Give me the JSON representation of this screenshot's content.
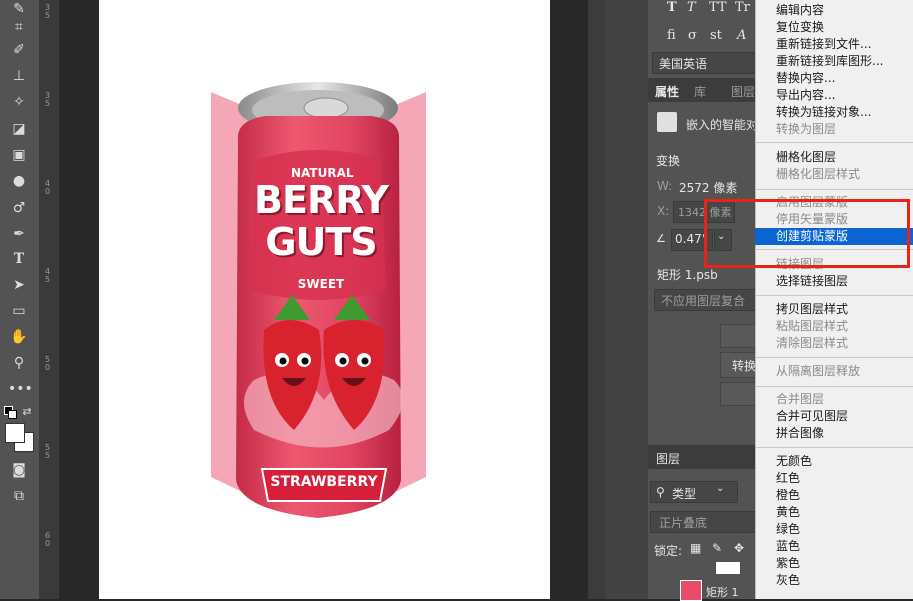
{
  "toolbar": {
    "tools": [
      "brush-tool-icon",
      "eraser-tool-icon",
      "crop-icon",
      "paintbrush-icon",
      "stamp-icon",
      "healing-brush-icon",
      "eraser-icon",
      "gradient-icon",
      "blur-drop-icon",
      "dodge-icon",
      "pen-tool-icon",
      "type-tool-icon",
      "path-selection-icon",
      "rectangle-icon",
      "hand-icon",
      "zoom-icon",
      "more-tools-icon"
    ],
    "type_glyph": "T"
  },
  "ruler": {
    "ticks": [
      "3",
      "5",
      "3",
      "5",
      "4",
      "0",
      "4",
      "5",
      "5",
      "0",
      "5",
      "5",
      "6",
      "0"
    ]
  },
  "can": {
    "brand_line1": "NATURAL",
    "brand_line2": "BERRY",
    "brand_line3": "GUTS",
    "brand_line4": "SWEET",
    "flavor": "STRAWBERRY"
  },
  "panel": {
    "character_row1": [
      "T",
      "T",
      "TT",
      "Tr"
    ],
    "character_row2": [
      "fi",
      "σ",
      "st",
      "A"
    ],
    "language": "美国英语",
    "tabs": [
      "属性",
      "库",
      "图层"
    ],
    "embedded_label": "嵌入的智能对",
    "transform_label": "变换",
    "w_label": "W:",
    "w_value": "2572 像素",
    "x_label": "X:",
    "x_value": "1342 像素",
    "angle_value": "0.47°",
    "file_name": "矩形 1.psb",
    "comp_placeholder": "不应用图层复合",
    "convert_label": "转换",
    "layers_tab": "图层",
    "filter_type": "类型",
    "blend_mode": "正片叠底",
    "lock_label": "锁定:",
    "layer_name": "矩形 1"
  },
  "menu": {
    "items": [
      {
        "label": "编辑内容",
        "state": "normal"
      },
      {
        "label": "复位变换",
        "state": "normal"
      },
      {
        "label": "重新链接到文件...",
        "state": "normal"
      },
      {
        "label": "重新链接到库图形...",
        "state": "normal"
      },
      {
        "label": "替换内容...",
        "state": "normal"
      },
      {
        "label": "导出内容...",
        "state": "normal"
      },
      {
        "label": "转换为链接对象...",
        "state": "normal"
      },
      {
        "label": "转换为图层",
        "state": "normal"
      },
      {
        "label": "栅格化图层",
        "state": "normal"
      },
      {
        "label": "栅格化图层样式",
        "state": "disabled"
      },
      {
        "label": "启用图层蒙版",
        "state": "disabled"
      },
      {
        "label": "停用矢量蒙版",
        "state": "disabled"
      },
      {
        "label": "创建剪贴蒙版",
        "state": "selected"
      },
      {
        "label": "链接图层",
        "state": "disabled"
      },
      {
        "label": "选择链接图层",
        "state": "normal"
      },
      {
        "label": "拷贝图层样式",
        "state": "normal"
      },
      {
        "label": "粘贴图层样式",
        "state": "disabled"
      },
      {
        "label": "清除图层样式",
        "state": "disabled"
      },
      {
        "label": "从隔离图层释放",
        "state": "disabled"
      },
      {
        "label": "合并图层",
        "state": "disabled"
      },
      {
        "label": "合并可见图层",
        "state": "normal"
      },
      {
        "label": "拼合图像",
        "state": "normal"
      },
      {
        "label": "无颜色",
        "state": "normal"
      },
      {
        "label": "红色",
        "state": "normal"
      },
      {
        "label": "橙色",
        "state": "normal"
      },
      {
        "label": "黄色",
        "state": "normal"
      },
      {
        "label": "绿色",
        "state": "normal"
      },
      {
        "label": "蓝色",
        "state": "normal"
      },
      {
        "label": "紫色",
        "state": "normal"
      },
      {
        "label": "灰色",
        "state": "normal"
      }
    ]
  },
  "colors": {
    "accent": "#0a64d2",
    "highlight": "#e8231a",
    "can_pink": "#e8506a"
  }
}
